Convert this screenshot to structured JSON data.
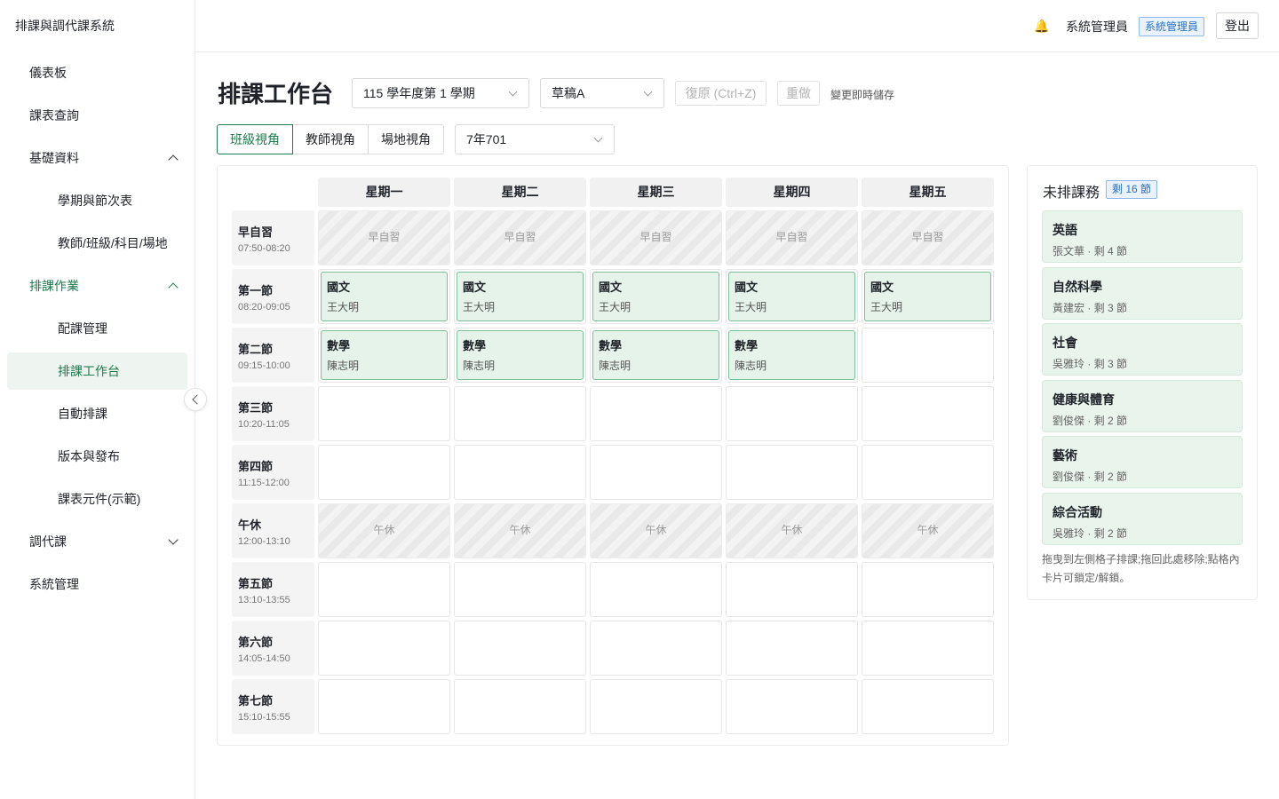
{
  "app": {
    "title": "排課與調代課系統"
  },
  "sidebar": {
    "items": [
      {
        "label": "儀表板"
      },
      {
        "label": "課表查詢"
      },
      {
        "label": "基礎資料"
      },
      {
        "label": "學期與節次表"
      },
      {
        "label": "教師/班級/科目/場地"
      },
      {
        "label": "排課作業"
      },
      {
        "label": "配課管理"
      },
      {
        "label": "排課工作台"
      },
      {
        "label": "自動排課"
      },
      {
        "label": "版本與發布"
      },
      {
        "label": "課表元件(示範)"
      },
      {
        "label": "調代課"
      },
      {
        "label": "系統管理"
      }
    ]
  },
  "header": {
    "bell_glyph": "🔔",
    "user_name": "系統管理員",
    "role_badge": "系統管理員",
    "logout_label": "登出"
  },
  "toolbar": {
    "page_title": "排課工作台",
    "semester_value": "115 學年度第 1 學期",
    "draft_value": "草稿A",
    "undo_label": "復原 (Ctrl+Z)",
    "redo_label": "重做",
    "autosave_text": "變更即時儲存",
    "views": [
      "班級視角",
      "教師視角",
      "場地視角"
    ],
    "active_view": "班級視角",
    "class_value": "7年701"
  },
  "timetable": {
    "days": [
      "星期一",
      "星期二",
      "星期三",
      "星期四",
      "星期五"
    ],
    "periods": [
      {
        "name": "早自習",
        "time": "07:50-08:20",
        "blocked": true,
        "blocked_label": "早自習",
        "lessons": []
      },
      {
        "name": "第一節",
        "time": "08:20-09:05",
        "blocked": false,
        "lessons": [
          {
            "subject": "國文",
            "teacher": "王大明"
          },
          {
            "subject": "國文",
            "teacher": "王大明"
          },
          {
            "subject": "國文",
            "teacher": "王大明"
          },
          {
            "subject": "國文",
            "teacher": "王大明"
          },
          {
            "subject": "國文",
            "teacher": "王大明"
          }
        ]
      },
      {
        "name": "第二節",
        "time": "09:15-10:00",
        "blocked": false,
        "lessons": [
          {
            "subject": "數學",
            "teacher": "陳志明"
          },
          {
            "subject": "數學",
            "teacher": "陳志明"
          },
          {
            "subject": "數學",
            "teacher": "陳志明"
          },
          {
            "subject": "數學",
            "teacher": "陳志明"
          },
          null
        ]
      },
      {
        "name": "第三節",
        "time": "10:20-11:05",
        "blocked": false,
        "lessons": []
      },
      {
        "name": "第四節",
        "time": "11:15-12:00",
        "blocked": false,
        "lessons": []
      },
      {
        "name": "午休",
        "time": "12:00-13:10",
        "blocked": true,
        "blocked_label": "午休",
        "lessons": []
      },
      {
        "name": "第五節",
        "time": "13:10-13:55",
        "blocked": false,
        "lessons": []
      },
      {
        "name": "第六節",
        "time": "14:05-14:50",
        "blocked": false,
        "lessons": []
      },
      {
        "name": "第七節",
        "time": "15:10-15:55",
        "blocked": false,
        "lessons": []
      }
    ]
  },
  "tasks": {
    "title": "未排課務",
    "remaining_badge": "剩 16 節",
    "items": [
      {
        "subject": "英語",
        "meta": "張文華 · 剩 4 節"
      },
      {
        "subject": "自然科學",
        "meta": "黃建宏 · 剩 3 節"
      },
      {
        "subject": "社會",
        "meta": "吳雅玲 · 剩 3 節"
      },
      {
        "subject": "健康與體育",
        "meta": "劉俊傑 · 剩 2 節"
      },
      {
        "subject": "藝術",
        "meta": "劉俊傑 · 剩 2 節"
      },
      {
        "subject": "綜合活動",
        "meta": "吳雅玲 · 剩 2 節"
      }
    ],
    "hint": "拖曳到左側格子排課;拖回此處移除;點格內卡片可鎖定/解鎖。"
  }
}
